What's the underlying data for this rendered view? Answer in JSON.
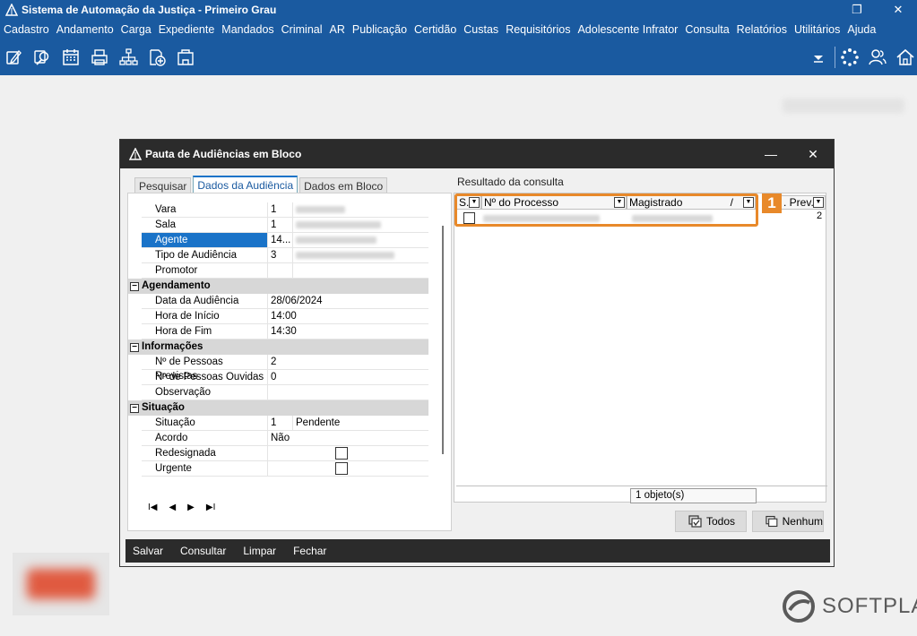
{
  "window": {
    "title": "Sistema de Automação da Justiça - Primeiro Grau",
    "restore_glyph": "❐",
    "close_glyph": "✕"
  },
  "menu": [
    "Cadastro",
    "Andamento",
    "Carga",
    "Expediente",
    "Mandados",
    "Criminal",
    "AR",
    "Publicação",
    "Certidão",
    "Custas",
    "Requisitórios",
    "Adolescente Infrator",
    "Consulta",
    "Relatórios",
    "Utilitários",
    "Ajuda"
  ],
  "toolbar_icons": [
    "edit-icon",
    "search-icon",
    "calendar-icon",
    "printer-icon",
    "hierarchy-icon",
    "add-doc-icon",
    "folder-icon",
    "dropdown-arrow-icon",
    "loading-icon",
    "users-icon",
    "home-icon"
  ],
  "dialog": {
    "title": "Pauta de Audiências em Bloco",
    "close_glyph": "✕",
    "minimize_glyph": "—",
    "tabs": [
      "Pesquisar",
      "Dados da Audiência",
      "Dados em Bloco"
    ],
    "active_tab": 1,
    "fields": {
      "vara": {
        "label": "Vara",
        "value": "1"
      },
      "sala": {
        "label": "Sala",
        "value": "1"
      },
      "agente": {
        "label": "Agente",
        "value": "14..."
      },
      "tipo": {
        "label": "Tipo de Audiência",
        "value": "3"
      },
      "promotor": {
        "label": "Promotor",
        "value": ""
      }
    },
    "agendamento": {
      "title": "Agendamento",
      "data_label": "Data da Audiência",
      "data_value": "28/06/2024",
      "inicio_label": "Hora de Início",
      "inicio_value": "14:00",
      "fim_label": "Hora de Fim",
      "fim_value": "14:30"
    },
    "informacoes": {
      "title": "Informações",
      "previstas_label": "Nº de Pessoas Previstas",
      "previstas_value": "2",
      "ouvidas_label": "Nº de Pessoas Ouvidas",
      "ouvidas_value": "0",
      "obs_label": "Observação",
      "obs_value": ""
    },
    "situacao": {
      "title": "Situação",
      "situacao_label": "Situação",
      "situacao_code": "1",
      "situacao_value": "Pendente",
      "acordo_label": "Acordo",
      "acordo_value": "Não",
      "redesignada_label": "Redesignada",
      "urgente_label": "Urgente"
    },
    "nav": [
      "I◀",
      "◀",
      "▶",
      "▶I"
    ],
    "result": {
      "label": "Resultado da consulta",
      "columns": [
        "S.",
        "Nº do Processo",
        "Magistrado",
        "/",
        ". Prev."
      ],
      "row_count_value": "2",
      "status": "1 objeto(s)",
      "highlight_number": "1",
      "btn_todos": "Todos",
      "btn_nenhum": "Nenhum"
    },
    "footer": [
      "Salvar",
      "Consultar",
      "Limpar",
      "Fechar"
    ]
  },
  "brand": "SOFTPLAN"
}
